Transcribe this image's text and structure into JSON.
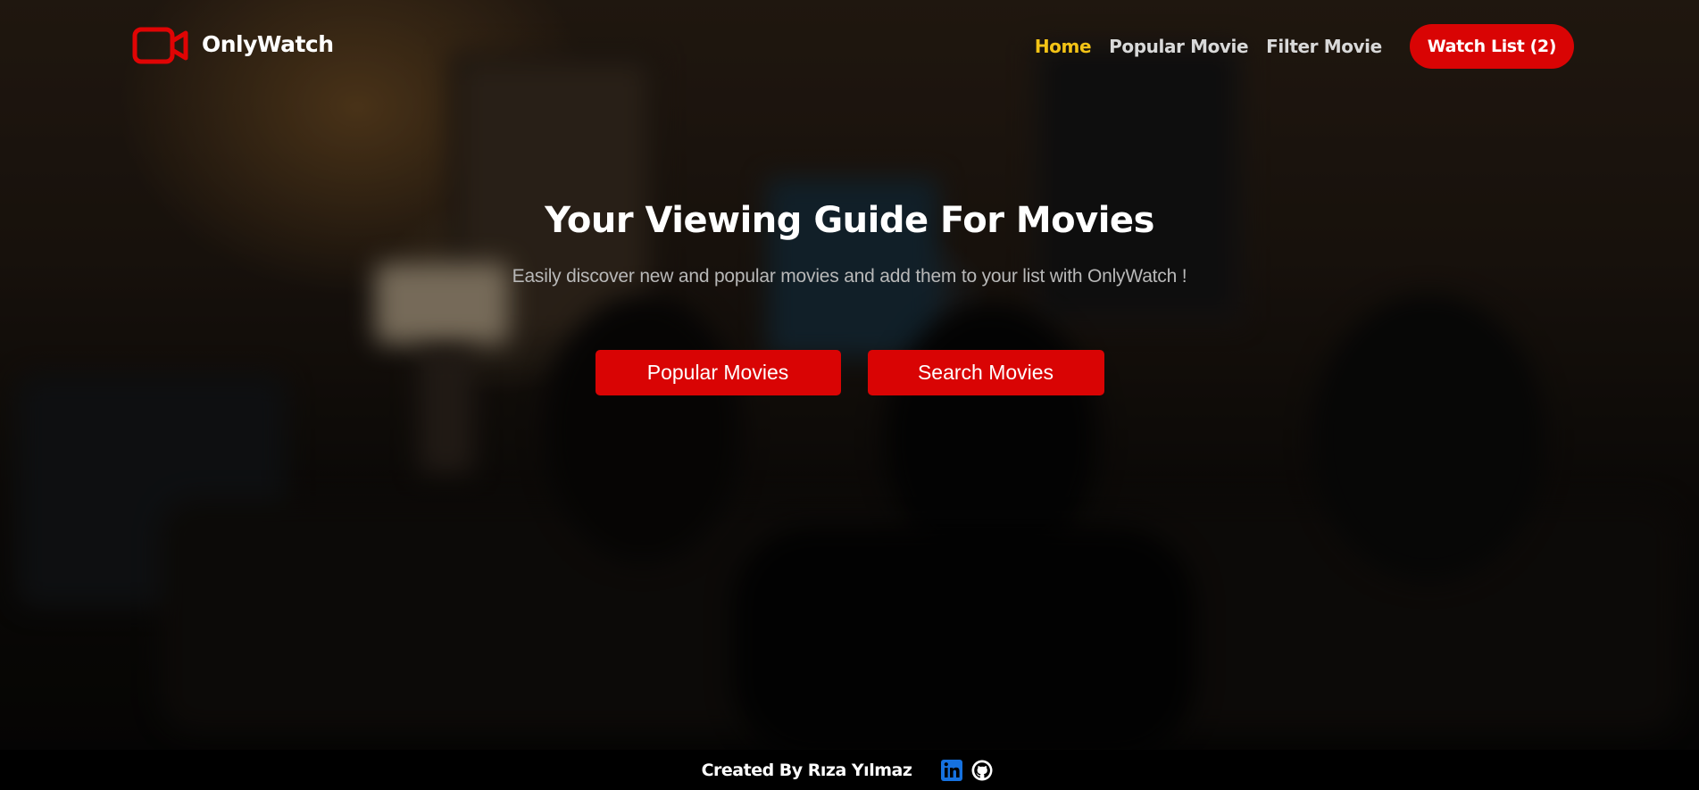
{
  "brand": {
    "name": "OnlyWatch",
    "logo_icon": "video-camera-icon",
    "accent_color": "#d90404"
  },
  "nav": {
    "items": [
      {
        "label": "Home",
        "active": true
      },
      {
        "label": "Popular Movie",
        "active": false
      },
      {
        "label": "Filter Movie",
        "active": false
      }
    ],
    "active_color": "#f3c316",
    "watch_list_label": "Watch List (2)"
  },
  "hero": {
    "title": "Your Viewing Guide For Movies",
    "subtitle": "Easily discover new and popular movies and add them to your list with OnlyWatch !",
    "buttons": {
      "popular": "Popular Movies",
      "search": "Search Movies"
    }
  },
  "footer": {
    "credit": "Created By Rıza Yılmaz",
    "social_icons": [
      "linkedin-icon",
      "github-icon"
    ]
  }
}
